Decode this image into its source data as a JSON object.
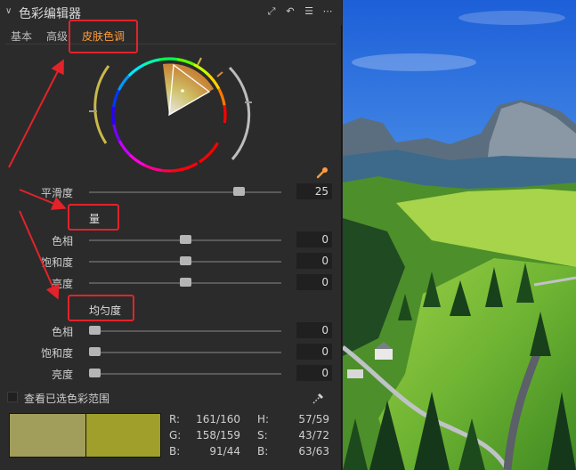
{
  "panel": {
    "title": "色彩编辑器",
    "tools": [
      "expand-icon",
      "reset-icon",
      "menu-icon",
      "more-icon"
    ],
    "tabs": [
      {
        "label": "基本",
        "active": false
      },
      {
        "label": "高级",
        "active": false
      },
      {
        "label": "皮肤色调",
        "active": true
      }
    ],
    "smoothness": {
      "label": "平滑度",
      "value": "25",
      "level": 0.8
    },
    "amount": {
      "header": "量",
      "hue": {
        "label": "色相",
        "value": "0",
        "level": 0.5
      },
      "saturation": {
        "label": "饱和度",
        "value": "0",
        "level": 0.5
      },
      "lightness": {
        "label": "亮度",
        "value": "0",
        "level": 0.5
      }
    },
    "uniformity": {
      "header": "均匀度",
      "hue": {
        "label": "色相",
        "value": "0",
        "level": 0.0
      },
      "saturation": {
        "label": "饱和度",
        "value": "0",
        "level": 0.0
      },
      "lightness": {
        "label": "亮度",
        "value": "0",
        "level": 0.0
      }
    },
    "view_selected_range": {
      "label": "查看已选色彩范围",
      "checked": false
    },
    "swatches": {
      "left": "#a19e5b",
      "right": "#a09f2c"
    },
    "readouts": {
      "R": "161/160",
      "G": "158/159",
      "B": "91/44",
      "H": "57/59",
      "S": "43/72",
      "Bv": "63/63",
      "R_label": "R:",
      "G_label": "G:",
      "B_label": "B:",
      "H_label": "H:",
      "S_label": "S:",
      "Bv_label": "B:"
    }
  },
  "colors": {
    "accent": "#ff9b38",
    "annotation_red": "#e2232a"
  }
}
